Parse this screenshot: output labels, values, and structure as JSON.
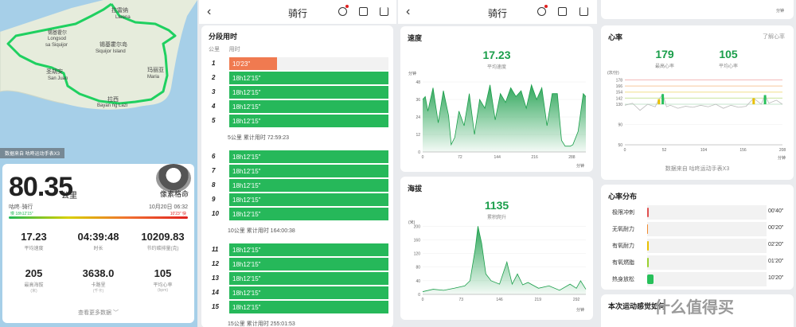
{
  "map": {
    "labels": [
      "拉雷纳",
      "Larena",
      "锡基霍尔",
      "Longsod",
      "sa Siquijor",
      "锡基霍尔岛",
      "Siquijor Island",
      "圣胡安",
      "San Juan",
      "玛丽亚",
      "Maria",
      "拉西",
      "Bayan ng Lazi"
    ],
    "source_tag": "数据来自 咕咚运动手表X3"
  },
  "summary": {
    "distance": "80.35",
    "distance_unit": "公里",
    "user_name": "像素格命",
    "app_activity": "咕咚·骑行",
    "date": "10月20日 06:32",
    "pace_left": "慢 18h12'15\"",
    "pace_right": "10'23\" 快",
    "stats": [
      {
        "value": "17.23",
        "label": "平均速度",
        "unit": ""
      },
      {
        "value": "04:39:48",
        "label": "时长",
        "unit": ""
      },
      {
        "value": "10209.83",
        "label": "节约碳排量(克)",
        "unit": ""
      },
      {
        "value": "205",
        "label": "最高海拔",
        "unit": "(米)"
      },
      {
        "value": "3638.0",
        "label": "卡路里",
        "unit": "(千卡)"
      },
      {
        "value": "105",
        "label": "平均心率",
        "unit": "(bpm)"
      }
    ],
    "more_label": "查看更多数据 ﹀"
  },
  "header": {
    "back": "‹",
    "title": "骑行"
  },
  "splits": {
    "title": "分段用时",
    "col_km": "公里",
    "col_time": "用时",
    "rows": [
      {
        "km": "1",
        "time": "10'23\"",
        "fast": true
      },
      {
        "km": "2",
        "time": "18h12'15\""
      },
      {
        "km": "3",
        "time": "18h12'15\""
      },
      {
        "km": "4",
        "time": "18h12'15\""
      },
      {
        "km": "5",
        "time": "18h12'15\""
      },
      {
        "km": "6",
        "time": "18h12'15\""
      },
      {
        "km": "7",
        "time": "18h12'15\""
      },
      {
        "km": "8",
        "time": "18h12'15\""
      },
      {
        "km": "9",
        "time": "18h12'15\""
      },
      {
        "km": "10",
        "time": "18h12'15\""
      },
      {
        "km": "11",
        "time": "18h12'15\""
      },
      {
        "km": "12",
        "time": "18h12'15\""
      },
      {
        "km": "13",
        "time": "18h12'15\""
      },
      {
        "km": "14",
        "time": "18h12'15\""
      },
      {
        "km": "15",
        "time": "18h12'15\""
      }
    ],
    "cum5": "5公里 累计用时 72:59:23",
    "cum10": "10公里 累计用时 164:00:38",
    "cum15": "15公里 累计用时 255:01:53"
  },
  "speed": {
    "title": "速度",
    "value": "17.23",
    "sub": "平均速度",
    "y_unit": "分钟",
    "x_unit": "分钟",
    "colors": {
      "line": "#1a9e4a",
      "fill": "#1a9e4a"
    }
  },
  "altitude": {
    "title": "海拔",
    "value": "1135",
    "sub": "累积爬升",
    "y_unit": "(米)",
    "x_unit": "分钟"
  },
  "heartrate": {
    "title": "心率",
    "more": "了解心率",
    "max_value": "179",
    "max_label": "最高心率",
    "avg_value": "105",
    "avg_label": "平均心率",
    "y_unit": "(次/分)",
    "x_unit": "分钟",
    "source": "数据来自 咕咚运动手表X3"
  },
  "hr_zones": {
    "title": "心率分布",
    "zones": [
      {
        "label": "极限冲刺",
        "time": "00'40\"",
        "pct": 1,
        "color": "#e05050"
      },
      {
        "label": "无氧耐力",
        "time": "00'20\"",
        "pct": 0.5,
        "color": "#f08a30"
      },
      {
        "label": "有氧耐力",
        "time": "02'20\"",
        "pct": 1,
        "color": "#e8c000"
      },
      {
        "label": "有氧燃脂",
        "time": "01'20\"",
        "pct": 1,
        "color": "#9ad030"
      },
      {
        "label": "热身放松",
        "time": "10'20\"",
        "pct": 4,
        "color": "#27c05a"
      }
    ]
  },
  "feedback_title": "本次运动感觉如何",
  "watermark": "什么值得买",
  "chart_data": [
    {
      "type": "area",
      "title": "速度",
      "xlabel": "分钟",
      "ylabel": "分钟",
      "x_ticks": [
        "0",
        "72",
        "144",
        "216",
        "288"
      ],
      "y_ticks": [
        "0",
        "12",
        "24",
        "36",
        "48"
      ],
      "ylim": [
        0,
        48
      ],
      "x": [
        0,
        5,
        10,
        15,
        20,
        30,
        40,
        50,
        55,
        62,
        70,
        80,
        90,
        100,
        110,
        120,
        130,
        140,
        150,
        160,
        170,
        180,
        190,
        200,
        210,
        220,
        230,
        240,
        250,
        260,
        268,
        275,
        285,
        290,
        300,
        310,
        315
      ],
      "values": [
        36,
        38,
        28,
        36,
        44,
        20,
        42,
        25,
        5,
        10,
        28,
        18,
        40,
        12,
        36,
        30,
        46,
        22,
        40,
        34,
        44,
        38,
        42,
        30,
        46,
        36,
        44,
        18,
        40,
        40,
        8,
        4,
        4,
        5,
        14,
        40,
        38
      ]
    },
    {
      "type": "area",
      "title": "海拔",
      "xlabel": "分钟",
      "ylabel": "(米)",
      "x_ticks": [
        "0",
        "73",
        "146",
        "219",
        "292"
      ],
      "y_ticks": [
        "0",
        "40",
        "80",
        "120",
        "160",
        "200"
      ],
      "ylim": [
        0,
        210
      ],
      "x": [
        0,
        20,
        40,
        60,
        80,
        90,
        100,
        105,
        112,
        120,
        130,
        146,
        160,
        170,
        180,
        190,
        200,
        220,
        240,
        260,
        280,
        292,
        300,
        310
      ],
      "values": [
        8,
        15,
        12,
        18,
        25,
        40,
        135,
        200,
        150,
        60,
        40,
        30,
        95,
        30,
        60,
        28,
        35,
        18,
        25,
        12,
        30,
        18,
        40,
        15
      ]
    },
    {
      "type": "line",
      "title": "心率",
      "xlabel": "分钟",
      "ylabel": "(次/分)",
      "x_ticks": [
        "0",
        "52",
        "104",
        "156",
        "208"
      ],
      "y_ticks": [
        "50",
        "90",
        "130",
        "142",
        "154",
        "166",
        "178"
      ],
      "ylim": [
        50,
        185
      ],
      "x": [
        0,
        10,
        20,
        30,
        40,
        45,
        50,
        55,
        60,
        70,
        80,
        90,
        100,
        110,
        120,
        130,
        140,
        150,
        160,
        170,
        180,
        185,
        190,
        200,
        208
      ],
      "values": [
        128,
        132,
        118,
        130,
        125,
        140,
        150,
        125,
        128,
        122,
        126,
        124,
        128,
        125,
        130,
        122,
        128,
        124,
        126,
        142,
        130,
        148,
        132,
        138,
        130
      ]
    }
  ]
}
